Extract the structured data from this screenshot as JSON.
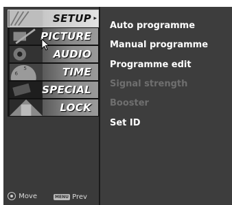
{
  "sidebar": {
    "tabs": [
      {
        "label": "SETUP",
        "icon": "setup-icon",
        "active": true
      },
      {
        "label": "PICTURE",
        "icon": "picture-icon",
        "active": false
      },
      {
        "label": "AUDIO",
        "icon": "audio-icon",
        "active": false
      },
      {
        "label": "TIME",
        "icon": "time-icon",
        "active": false
      },
      {
        "label": "SPECIAL",
        "icon": "special-icon",
        "active": false
      },
      {
        "label": "LOCK",
        "icon": "lock-icon",
        "active": false
      }
    ],
    "hint_move": "Move",
    "hint_menu_key": "MENU",
    "hint_prev": "Prev"
  },
  "submenu": {
    "items": [
      {
        "label": "Auto programme",
        "enabled": true
      },
      {
        "label": "Manual programme",
        "enabled": true
      },
      {
        "label": "Programme edit",
        "enabled": true
      },
      {
        "label": "Signal strength",
        "enabled": false
      },
      {
        "label": "Booster",
        "enabled": false
      },
      {
        "label": "Set ID",
        "enabled": true
      }
    ]
  },
  "colors": {
    "accent_active": "#e2e2e2",
    "disabled_text": "#6f6f6f",
    "panel": "#3d3d3d"
  }
}
